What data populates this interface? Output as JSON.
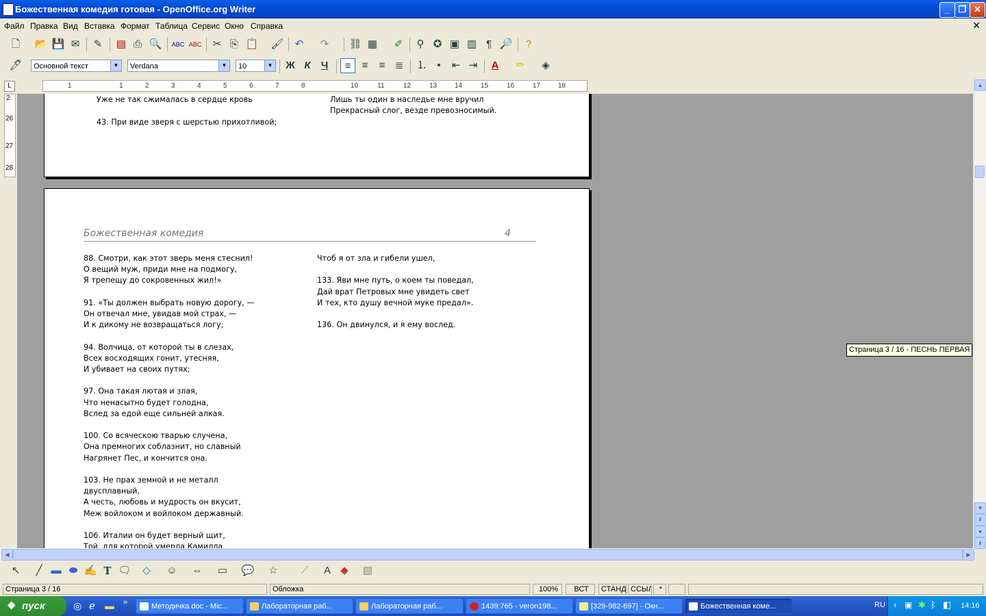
{
  "window": {
    "title": "Божественная комедия готовая - OpenOffice.org Writer",
    "minimize": "_",
    "maximize": "❐",
    "close": "✕"
  },
  "menu": [
    "Файл",
    "Правка",
    "Вид",
    "Вставка",
    "Формат",
    "Таблица",
    "Сервис",
    "Окно",
    "Справка"
  ],
  "formatting": {
    "style": "Основной текст",
    "font": "Verdana",
    "size": "10",
    "bold": "Ж",
    "italic": "К",
    "underline": "Ч"
  },
  "ruler_labels": [
    "1",
    "1",
    "2",
    "3",
    "4",
    "5",
    "6",
    "7",
    "8",
    "10",
    "11",
    "12",
    "13",
    "14",
    "15",
    "16",
    "17",
    "18"
  ],
  "vertical_ruler": [
    "2",
    "26",
    "27",
    "28"
  ],
  "page_prev": {
    "left_lines": [
      "Уже не так сжималась в сердце кровь",
      "",
      "43. При виде зверя с шерстью прихотливой;"
    ],
    "right_lines": [
      "Лишь ты один в наследье мне вручил",
      "Прекрасный слог, везде превозносимый."
    ]
  },
  "page_current": {
    "running_title": "Божественная комедия",
    "page_number": "4",
    "left_lines": [
      "88. Смотри, как этот зверь меня стеснил!",
      "О вещий муж, приди мне на подмогу,",
      "Я трепещу до сокровенных жил!»",
      "",
      "91. «Ты должен выбрать новую дорогу, —",
      "Он отвечал мне, увидав мой страх, —",
      "И к дикому не возвращаться логу;",
      "",
      "94. Волчица, от которой ты в слезах,",
      "Всех восходящих гонит, утесняя,",
      "И убивает на своих путях;",
      "",
      "97. Она такая лютая и злая,",
      "Что ненасытно будет голодна,",
      "Вслед за едой еще сильней алкая.",
      "",
      "100. Со всяческою тварью случена,",
      "Она премногих соблазнит, но славный",
      "Нагрянет Пес, и кончится она.",
      "",
      "103. Не прах земной и не металл",
      "двусплавный,",
      "А честь, любовь и мудрость он вкусит,",
      "Меж войлоком и войлоком державный.",
      "",
      "106. Италии он будет верный щит,",
      "Той, для которой умерла Камилла,"
    ],
    "right_lines": [
      "Чтоб я от зла и гибели ушел,",
      "",
      "133. Яви мне путь, о коем ты поведал,",
      "Дай врат Петровых мне увидеть свет",
      "И тех, кто душу вечной муке предал».",
      "",
      "136. Он двинулся, и я ему вослед."
    ]
  },
  "tooltip": "Страница  3 / 16  - ПЕСНЬ ПЕРВАЯ",
  "status": {
    "page": "Страница  3 / 16",
    "style": "Обложка",
    "zoom": "100%",
    "insert": "ВСТ",
    "mode": "СТАНД",
    "link": "ССЫЛ",
    "modified": "*"
  },
  "taskbar": {
    "start": "пуск",
    "tasks": [
      "Методичка.doc - Mic...",
      "Лабораторная раб...",
      "Лабораторная раб...",
      "1439:765 - veron198...",
      "[329-982-697] - Окн...",
      "Божественная коме..."
    ],
    "lang": "RU",
    "clock": "14:16"
  }
}
